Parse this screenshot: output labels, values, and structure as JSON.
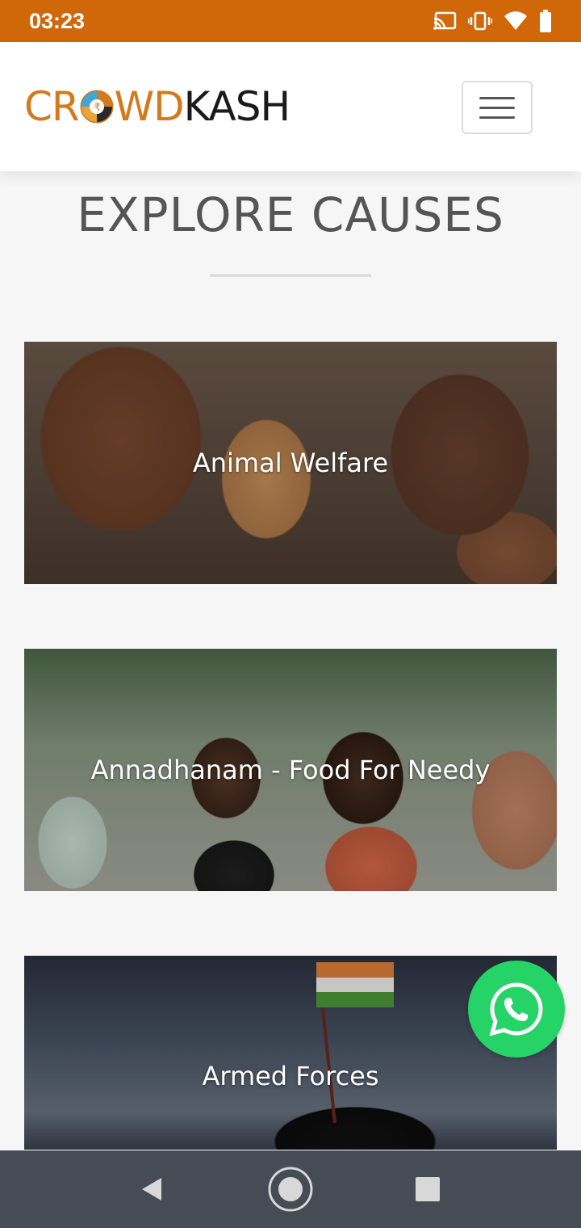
{
  "status_bar": {
    "time": "03:23",
    "icons": [
      "cast-icon",
      "vibrate-icon",
      "wifi-icon",
      "battery-icon"
    ],
    "background": "#d0680a"
  },
  "header": {
    "logo": {
      "part1": "CR",
      "part2": "WD",
      "part3": "KASH",
      "o_glyph": "₹"
    },
    "menu_icon": "hamburger-menu-icon"
  },
  "page": {
    "title": "EXPLORE CAUSES"
  },
  "causes": [
    {
      "label": "Animal Welfare"
    },
    {
      "label": "Annadhanam - Food For Needy"
    },
    {
      "label": "Armed Forces"
    }
  ],
  "floating": {
    "icon": "whatsapp-icon",
    "color": "#25d366"
  },
  "nav_bar": {
    "back": "back-icon",
    "home": "home-icon",
    "recents": "recents-icon"
  }
}
